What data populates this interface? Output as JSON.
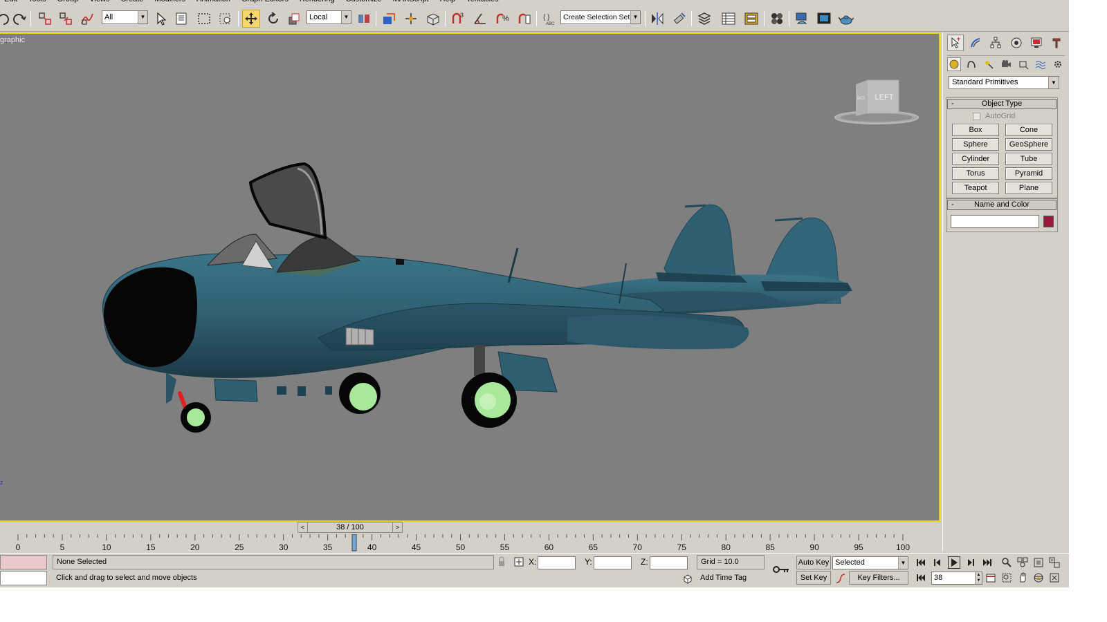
{
  "menubar": [
    "Edit",
    "Tools",
    "Group",
    "Views",
    "Create",
    "Modifiers",
    "Animation",
    "Graph Editors",
    "Rendering",
    "Customize",
    "MAXScript",
    "Help",
    "Tentacles"
  ],
  "toolbar": {
    "selection_filter": "All",
    "reference_coord": "Local",
    "named_selection_placeholder": "Create Selection Set"
  },
  "viewport": {
    "label": "graphic",
    "viewcube_face": "LEFT",
    "viewcube_side": "BACK",
    "axis_label": "z"
  },
  "command_panel": {
    "category": "Standard Primitives",
    "object_type": {
      "title": "Object Type",
      "collapse": "-",
      "autogrid": "AutoGrid",
      "buttons": [
        "Box",
        "Cone",
        "Sphere",
        "GeoSphere",
        "Cylinder",
        "Tube",
        "Torus",
        "Pyramid",
        "Teapot",
        "Plane"
      ]
    },
    "name_color": {
      "title": "Name and Color",
      "collapse": "-",
      "name_value": "",
      "color": "#9a1a3a"
    }
  },
  "timeline": {
    "slider_text": "38 / 100",
    "current_frame": 38,
    "frame_count": 100,
    "ticks": [
      "0",
      "5",
      "10",
      "15",
      "20",
      "25",
      "30",
      "35",
      "40",
      "45",
      "50",
      "55",
      "60",
      "65",
      "70",
      "75",
      "80",
      "85",
      "90",
      "95",
      "100"
    ]
  },
  "status": {
    "selection": "None Selected",
    "prompt": "Click and drag to select and move objects",
    "x_label": "X:",
    "y_label": "Y:",
    "z_label": "Z:",
    "grid": "Grid = 10.0",
    "add_time_tag": "Add Time Tag",
    "auto_key": "Auto Key",
    "set_key": "Set Key",
    "key_mode": "Selected",
    "key_filters": "Key Filters...",
    "frame_value": "38"
  },
  "colors": {
    "viewport_bg": "#7f7f7f",
    "viewport_border": "#e8d400",
    "aircraft_body": "#2f5f72",
    "wheel_hub": "#a8e89a",
    "nose_gear": "#e02020"
  }
}
